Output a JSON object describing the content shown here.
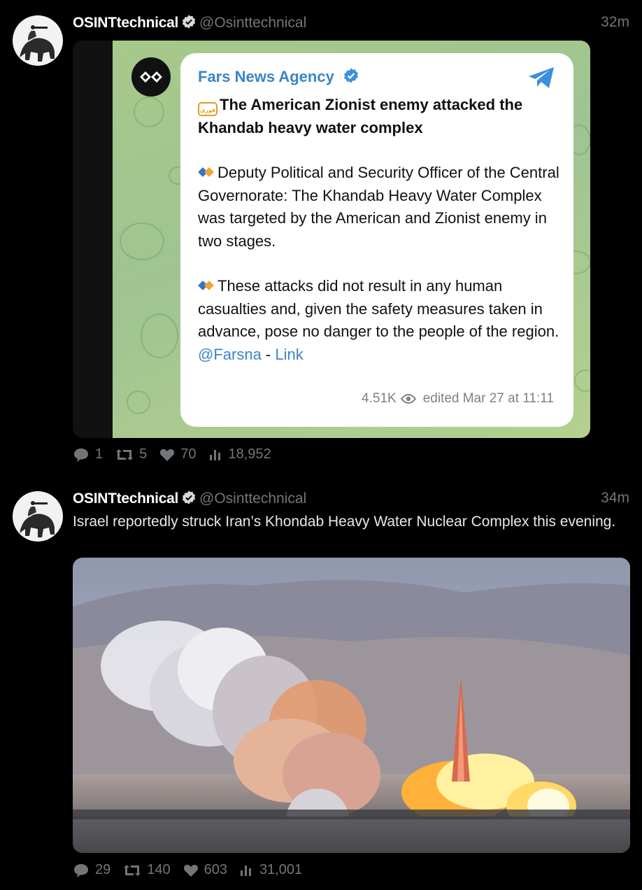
{
  "posts": [
    {
      "author_name": "OSINTtechnical",
      "handle": "@Osinttechnical",
      "time": "32m",
      "text": "",
      "media": {
        "type": "telegram-screenshot",
        "channel": "Fars News Agency",
        "fars_badge": "فوری",
        "title": "The American Zionist enemy attacked the Khandab heavy water complex",
        "paragraph1": "Deputy Political and Security Officer of the Central Governorate: The Khandab Heavy Water Complex was targeted by the American and Zionist enemy in two stages.",
        "paragraph2": "These attacks did not result in any human casualties and, given the safety measures taken in advance, pose no danger to the people of the region.",
        "mention": "@Farsna",
        "separator": " - ",
        "link": "Link",
        "views": "4.51K",
        "edited": "edited Mar 27 at 11:11"
      },
      "stats": {
        "replies": "1",
        "reposts": "5",
        "likes": "70",
        "views": "18,952"
      }
    },
    {
      "author_name": "OSINTtechnical",
      "handle": "@Osinttechnical",
      "time": "34m",
      "text": "Israel reportedly struck Iran’s Khondab Heavy Water Nuclear Complex this evening.",
      "media": {
        "type": "photo"
      },
      "stats": {
        "replies": "29",
        "reposts": "140",
        "likes": "603",
        "views": "31,001"
      }
    }
  ],
  "colors": {
    "verified": "#1d9bf0",
    "telegram_link": "#3b85c7",
    "muted": "#71767b",
    "background": "#000000"
  },
  "icons": [
    "verified-badge-icon",
    "telegram-plane-icon",
    "eye-icon",
    "reply-icon",
    "repost-icon",
    "like-icon",
    "views-icon"
  ]
}
